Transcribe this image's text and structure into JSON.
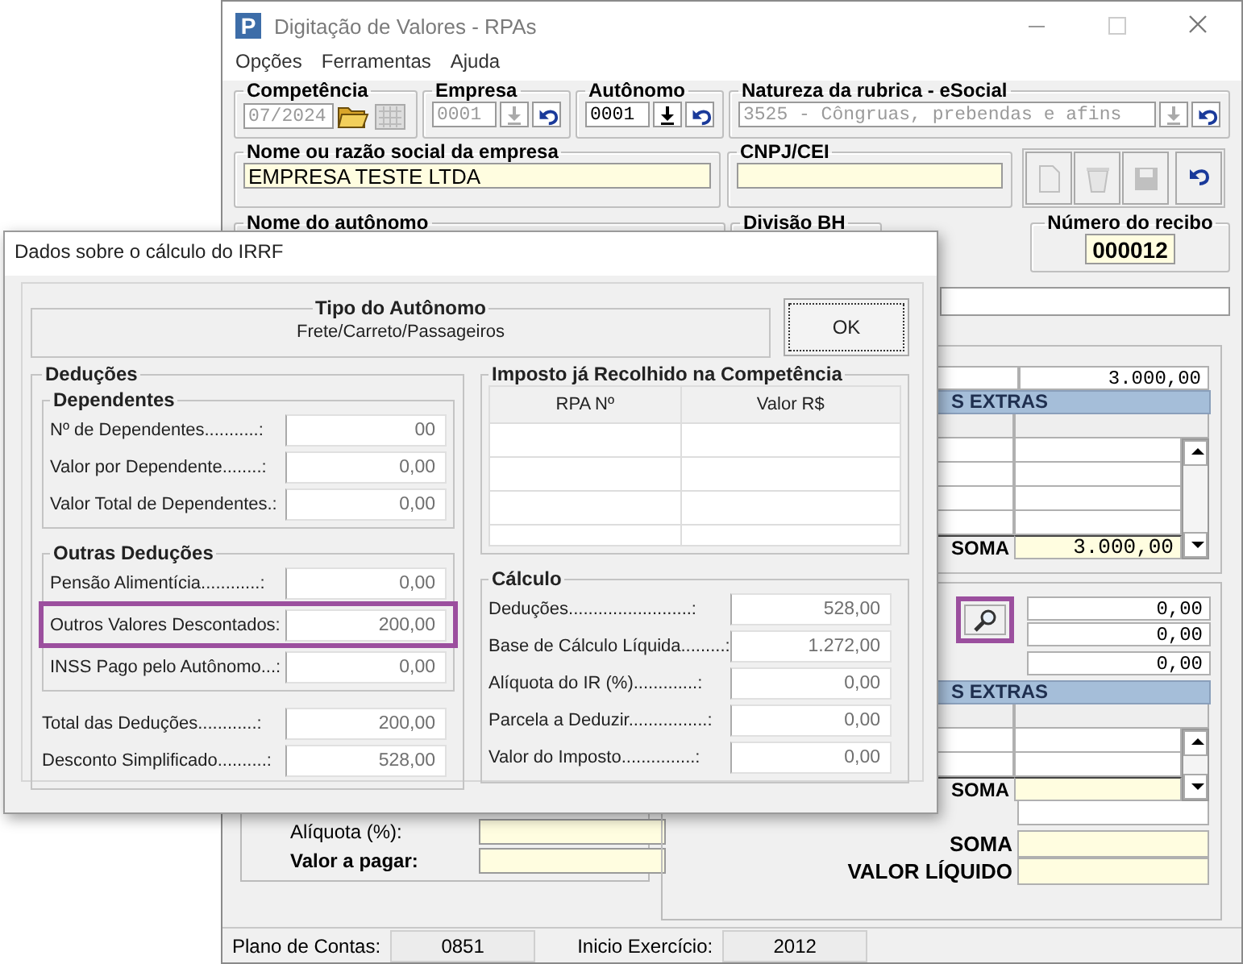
{
  "main_window": {
    "logo": "P",
    "title": "Digitação de Valores - RPAs",
    "menu": [
      "Opções",
      "Ferramentas",
      "Ajuda"
    ],
    "competencia": {
      "label": "Competência",
      "value": "07/2024"
    },
    "empresa": {
      "label": "Empresa",
      "value": "0001",
      "disabled": true
    },
    "autonomo": {
      "label": "Autônomo",
      "value": "0001",
      "disabled": false
    },
    "natureza": {
      "label": "Natureza da rubrica - eSocial",
      "value": "3525 - Côngruas, prebendas e afins"
    },
    "nome_empresa": {
      "label": "Nome ou razão social da empresa",
      "value": "EMPRESA TESTE LTDA"
    },
    "cnpj": {
      "label": "CNPJ/CEI"
    },
    "toolbar": [
      {
        "kind": "new",
        "disabled": true
      },
      {
        "kind": "delete",
        "disabled": true
      },
      {
        "kind": "save",
        "disabled": true
      },
      {
        "kind": "undo",
        "disabled": false
      }
    ],
    "nome_autonomo": {
      "label": "Nome do autônomo"
    },
    "divisao_bh": {
      "label": "Divisão BH"
    },
    "numero_recibo": {
      "label": "Número do recibo",
      "value": "000012"
    },
    "panel_1": {
      "value": "3.000,00",
      "header": "S EXTRAS",
      "sum_label": "SOMA",
      "sum_value": "3.000,00"
    },
    "panel_2": {
      "search_button": {
        "highlighted": true
      },
      "values": [
        "0,00",
        "0,00",
        "0,00"
      ],
      "header": "S EXTRAS",
      "sum_label": "SOMA",
      "totals": [
        {
          "label": "SOMA"
        },
        {
          "label": "VALOR LÍQUIDO"
        }
      ]
    },
    "payment": {
      "rate_label": "Alíquota (%):",
      "amount_label": "Valor a pagar:"
    },
    "status_bar": [
      {
        "label": "Plano de Contas:",
        "value": "0851"
      },
      {
        "label": "Inicio Exercício:",
        "value": "2012"
      }
    ]
  },
  "dialog": {
    "title": "Dados sobre o cálculo do IRRF",
    "tipo": {
      "label": "Tipo do Autônomo",
      "value": "Frete/Carreto/Passageiros"
    },
    "ok_button": "OK",
    "deducoes": {
      "title": "Deduções",
      "groups": [
        {
          "title": "Dependentes",
          "rows": [
            {
              "label": "Nº de Dependentes...........:",
              "value": "00",
              "highlighted": false
            },
            {
              "label": "Valor por Dependente........:",
              "value": "0,00",
              "highlighted": false
            },
            {
              "label": "Valor Total de Dependentes.:",
              "value": "0,00",
              "highlighted": false
            }
          ]
        },
        {
          "title": "Outras Deduções",
          "rows": [
            {
              "label": "Pensão Alimentícia............:",
              "value": "0,00",
              "highlighted": false
            },
            {
              "label": "Outros Valores Descontados:",
              "value": "200,00",
              "highlighted": true
            },
            {
              "label": "INSS Pago pelo Autônomo...:",
              "value": "0,00",
              "highlighted": false
            }
          ]
        }
      ],
      "rows": [
        {
          "label": "Total das Deduções............:",
          "value": "200,00"
        },
        {
          "label": "Desconto Simplificado..........:",
          "value": "528,00"
        }
      ]
    },
    "imposto": {
      "title": "Imposto já Recolhido na Competência",
      "columns": [
        "RPA Nº",
        "Valor R$"
      ]
    },
    "calculo": {
      "title": "Cálculo",
      "rows": [
        {
          "label": "Deduções.........................:",
          "value": "528,00"
        },
        {
          "label": "Base de Cálculo Líquida.........:",
          "value": "1.272,00"
        },
        {
          "label": "Alíquota do IR (%).............:",
          "value": "0,00"
        },
        {
          "label": "Parcela a Deduzir................:",
          "value": "0,00"
        },
        {
          "label": "Valor do Imposto...............:",
          "value": "0,00"
        }
      ]
    }
  }
}
